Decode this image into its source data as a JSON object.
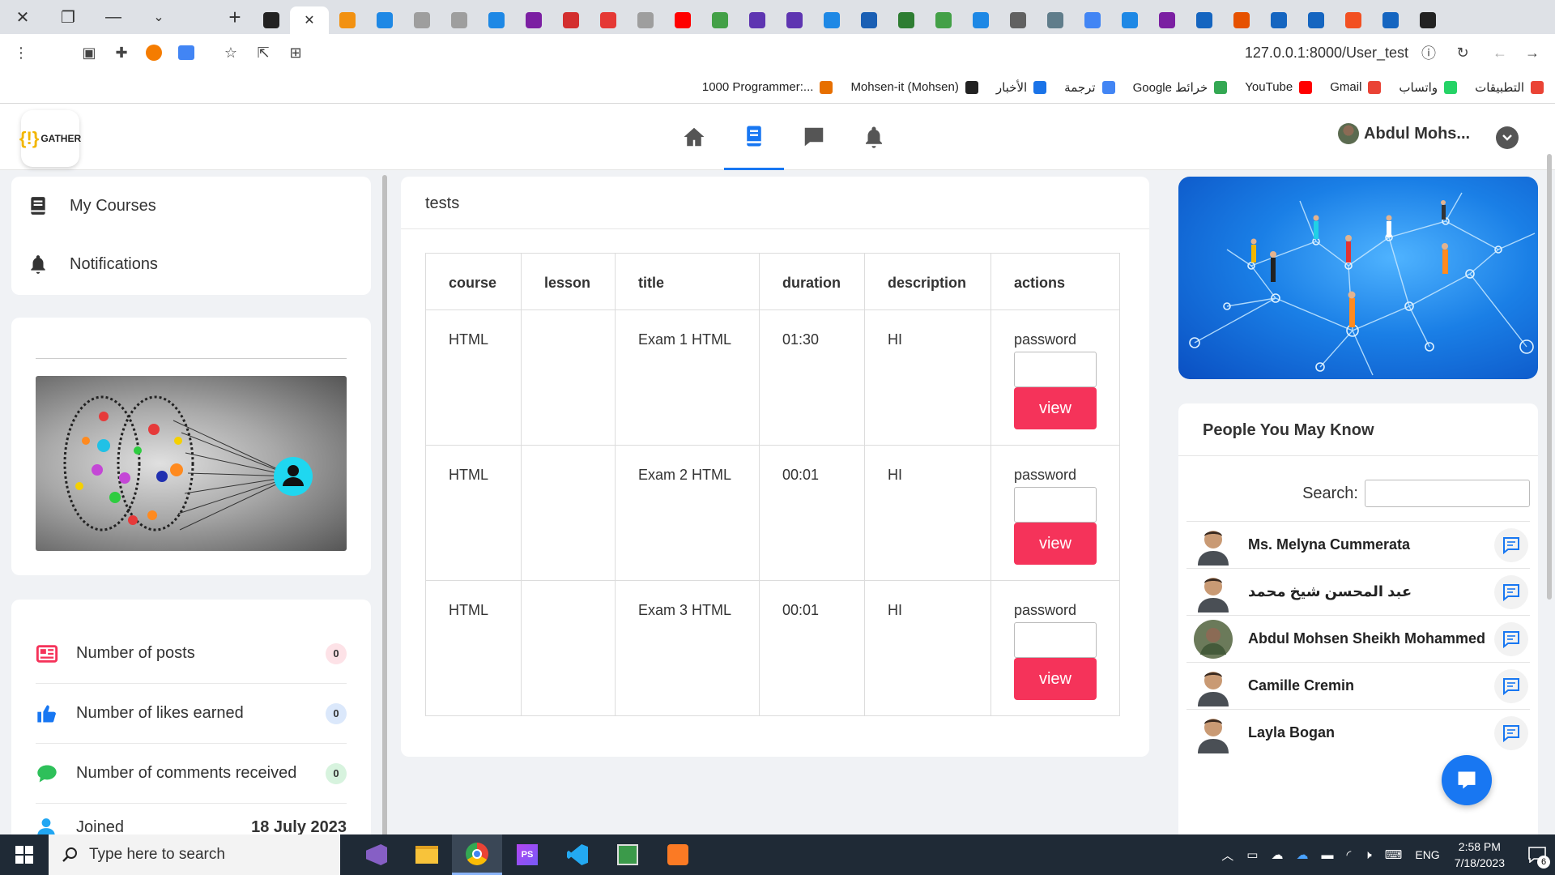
{
  "browser": {
    "url": "127.0.0.1:8000/User_test",
    "bookmarks": [
      {
        "label": "1000 Programmer:...",
        "color": "#e76f00"
      },
      {
        "label": "Mohsen-it (Mohsen)",
        "color": "#222222"
      },
      {
        "label": "الأخبار",
        "color": "#1a73e8"
      },
      {
        "label": "ترجمة",
        "color": "#4285f4"
      },
      {
        "label": "Google خرائط",
        "color": "#34a853"
      },
      {
        "label": "YouTube",
        "color": "#ff0000"
      },
      {
        "label": "Gmail",
        "color": "#ea4335"
      },
      {
        "label": "واتساب",
        "color": "#25d366"
      },
      {
        "label": "التطبيقات",
        "color": "#ea4335"
      }
    ],
    "tab_icons": [
      "#222222",
      "#ffffff",
      "#f29111",
      "#1e88e5",
      "#9e9e9e",
      "#9e9e9e",
      "#1e88e5",
      "#7b1fa2",
      "#d32f2f",
      "#e53935",
      "#9e9e9e",
      "#ff0000",
      "#43a047",
      "#5e35b1",
      "#5e35b1",
      "#1e88e5",
      "#1a5fb4",
      "#2e7d32",
      "#43a047",
      "#1e88e5",
      "#616161",
      "#607d8b",
      "#4285f4",
      "#1e88e5",
      "#7b1fa2",
      "#1565c0",
      "#e65100",
      "#1565c0",
      "#1565c0",
      "#f25022",
      "#1565c0",
      "#222222"
    ]
  },
  "header": {
    "logo_text": "GATHER",
    "user_name": "Abdul Mohs...",
    "accent": "#1877f2"
  },
  "sidebar": {
    "menu": [
      {
        "label": "My Courses",
        "icon": "book-icon"
      },
      {
        "label": "Notifications",
        "icon": "bell-icon"
      }
    ],
    "stats": [
      {
        "label": "Number of posts",
        "value": "0",
        "icon": "newspaper-icon",
        "color": "#f5335a",
        "badge_bg": "#fde2e7"
      },
      {
        "label": "Number of likes earned",
        "value": "0",
        "icon": "thumbs-up-icon",
        "color": "#1877f2",
        "badge_bg": "#dbe8fb"
      },
      {
        "label": "Number of comments received",
        "value": "0",
        "icon": "comment-icon",
        "color": "#2ec05a",
        "badge_bg": "#d7f3de"
      }
    ],
    "joined": {
      "label": "Joined",
      "date": "18 July 2023"
    }
  },
  "tests": {
    "title": "tests",
    "columns": [
      "course",
      "lesson",
      "title",
      "duration",
      "description",
      "actions"
    ],
    "password_label": "password",
    "view_label": "view",
    "rows": [
      {
        "course": "HTML",
        "lesson": "",
        "title": "Exam 1 HTML",
        "duration": "01:30",
        "description": "HI"
      },
      {
        "course": "HTML",
        "lesson": "",
        "title": "Exam 2 HTML",
        "duration": "00:01",
        "description": "HI"
      },
      {
        "course": "HTML",
        "lesson": "",
        "title": "Exam 3 HTML",
        "duration": "00:01",
        "description": "HI"
      }
    ]
  },
  "people": {
    "title": "People You May Know",
    "search_label": "Search:",
    "list": [
      {
        "name": "Ms. Melyna Cummerata"
      },
      {
        "name": "عبد المحسن شيخ محمد"
      },
      {
        "name": "Abdul Mohsen Sheikh Mohammed"
      },
      {
        "name": "Camille Cremin"
      },
      {
        "name": "Layla Bogan"
      }
    ]
  },
  "taskbar": {
    "search_placeholder": "Type here to search",
    "language": "ENG",
    "time": "2:58 PM",
    "date": "7/18/2023",
    "notification_count": "6"
  }
}
